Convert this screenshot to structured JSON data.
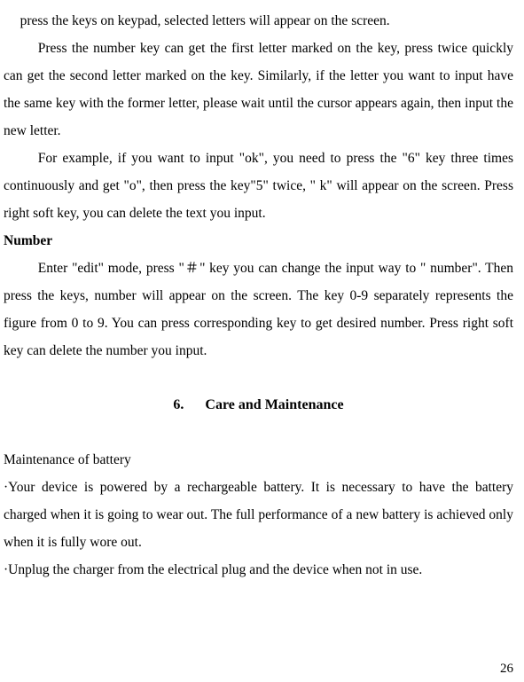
{
  "para_intro": "press the keys on keypad, selected letters will appear on the screen.",
  "para_press_number": "Press the number key can get the first letter marked on the key, press twice quickly can get the second letter marked on the key. Similarly, if the letter you want to input have the same key with the former letter, please wait until the cursor appears again, then input the new letter.",
  "para_example": "For example, if you want to input \"ok\", you need to press the \"6\" key three times continuously and get \"o\", then press the key\"5\" twice, \" k\" will appear on the screen. Press right soft key, you can delete the text you input.",
  "heading_number": "Number",
  "para_number": "Enter \"edit\" mode, press \"＃\" key you can change the input way to \" number\". Then press the keys, number will appear on the screen. The key 0-9 separately represents the figure from 0 to 9. You can press corresponding key to get desired number. Press right soft key can delete the number you input.",
  "chapter_num": "6.",
  "chapter_title": "Care and Maintenance",
  "subsection_maintenance": "Maintenance of battery",
  "bullet1": "·Your device is powered by a rechargeable battery. It is necessary to have the battery charged when it is going to wear out. The full performance of a new battery is achieved only when it is fully wore out.",
  "bullet2": "·Unplug the charger from the electrical plug and the device when not in use.",
  "page_number": "26"
}
